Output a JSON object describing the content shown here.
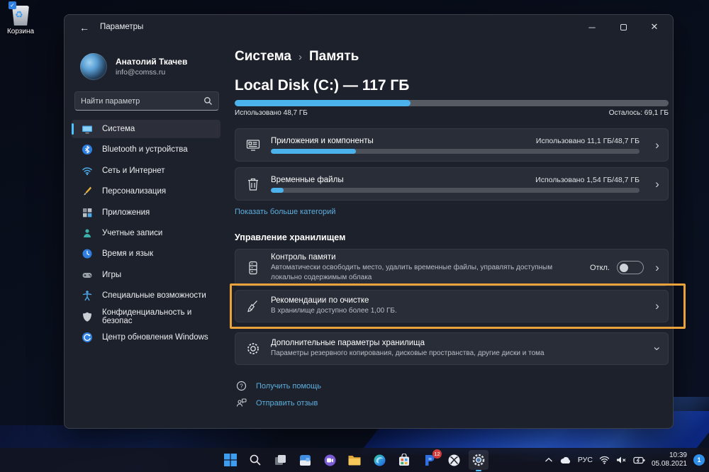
{
  "desktop": {
    "recycle_bin_label": "Корзина"
  },
  "window": {
    "titlebar": {
      "title": "Параметры",
      "back": "←",
      "minimize": "─",
      "close": "✕"
    },
    "sidebar": {
      "user": {
        "name": "Анатолий Ткачев",
        "email": "info@comss.ru"
      },
      "search_placeholder": "Найти параметр",
      "items": [
        {
          "label": "Система",
          "selected": true
        },
        {
          "label": "Bluetooth и устройства"
        },
        {
          "label": "Сеть и Интернет"
        },
        {
          "label": "Персонализация"
        },
        {
          "label": "Приложения"
        },
        {
          "label": "Учетные записи"
        },
        {
          "label": "Время и язык"
        },
        {
          "label": "Игры"
        },
        {
          "label": "Специальные возможности"
        },
        {
          "label": "Конфиденциальность и безопас"
        },
        {
          "label": "Центр обновления Windows"
        }
      ]
    },
    "main": {
      "breadcrumb": {
        "root": "Система",
        "separator": "›",
        "current": "Память"
      },
      "disk": {
        "title": "Local Disk (C:) — 117 ГБ",
        "used_label": "Использовано 48,7 ГБ",
        "free_label": "Осталось: 69,1 ГБ",
        "used_percent": 40.5
      },
      "categories": [
        {
          "title": "Приложения и компоненты",
          "usage": "Использовано 11,1 ГБ/48,7 ГБ",
          "percent": 23
        },
        {
          "title": "Временные файлы",
          "usage": "Использовано 1,54 ГБ/48,7 ГБ",
          "percent": 3.5
        }
      ],
      "show_more_link": "Показать больше категорий",
      "management": {
        "heading": "Управление хранилищем",
        "storage_sense": {
          "title": "Контроль памяти",
          "subtitle": "Автоматически освободить место, удалить временные файлы, управлять доступным локально содержимым облака",
          "toggle_label": "Откл.",
          "toggle_state": "off"
        },
        "cleanup": {
          "title": "Рекомендации по очистке",
          "subtitle": "В хранилище доступно более 1,00 ГБ.",
          "highlight_color": "#eba23a"
        },
        "advanced": {
          "title": "Дополнительные параметры хранилища",
          "subtitle": "Параметры резервного копирования, дисковые пространства, другие диски и тома"
        }
      },
      "footer_links": [
        {
          "label": "Получить помощь"
        },
        {
          "label": "Отправить отзыв"
        }
      ]
    }
  },
  "taskbar": {
    "pinned_badge_count": "12",
    "tray": {
      "language": "РУС",
      "time": "10:39",
      "date": "05.08.2021",
      "notification_count": "1"
    }
  },
  "colors": {
    "accent": "#4cc2ff",
    "progress_fill": "#4cb2ec",
    "link": "#5caede",
    "highlight_box": "#eba23a"
  }
}
